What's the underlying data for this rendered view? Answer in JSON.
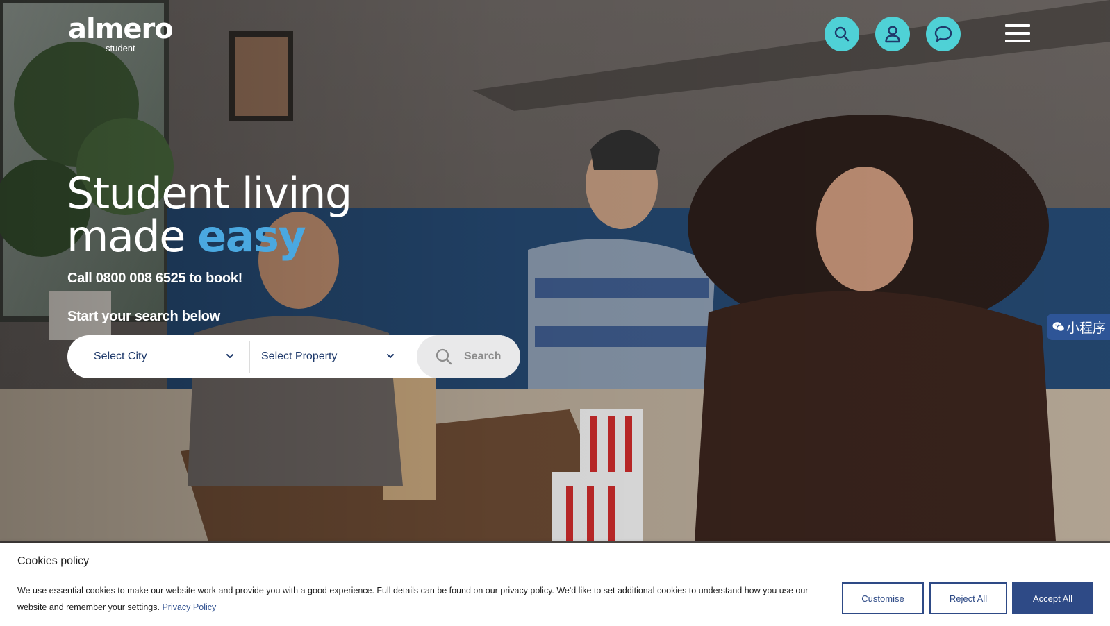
{
  "brand": {
    "name": "almero",
    "tagline": "student"
  },
  "header": {
    "icons": [
      "search-icon",
      "user-icon",
      "chat-icon",
      "menu-icon"
    ],
    "accent_color": "#4fd1d6"
  },
  "hero": {
    "headline_line1": "Student living",
    "headline_line2_plain": "made",
    "headline_line2_accent": "easy",
    "accent_color": "#4aa8e0",
    "callout": "Call 0800 008 6525 to book!",
    "search_heading": "Start your search below"
  },
  "search": {
    "city_select": "Select City",
    "property_select": "Select Property",
    "button_label": "Search"
  },
  "mini_program": {
    "label": "小程序"
  },
  "cookies": {
    "title": "Cookies policy",
    "text": "We use essential cookies to make our website work and provide you with a good experience. Full details can be found on our privacy policy. We'd like to set additional cookies to understand how you use our website and remember your settings.",
    "link_label": "Privacy Policy",
    "customise_label": "Customise",
    "reject_label": "Reject All",
    "accept_label": "Accept All",
    "button_color": "#2e4a86"
  }
}
